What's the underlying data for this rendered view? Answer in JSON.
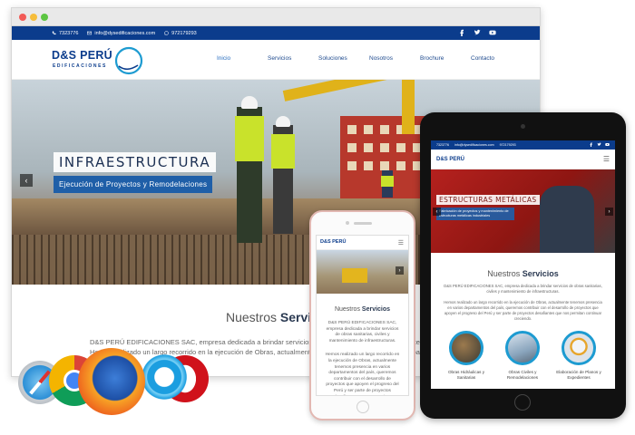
{
  "desktop": {
    "contact": {
      "phone": "7323776",
      "email": "info@dysedificaciones.com",
      "whatsapp": "972179293"
    },
    "social_icons": [
      "facebook-icon",
      "twitter-icon",
      "youtube-icon"
    ],
    "logo": {
      "brand": "D&S PERÚ",
      "sub": "EDIFICACIONES"
    },
    "menu": [
      "Inicio",
      "Servicios",
      "Soluciones",
      "Nosotros",
      "Brochure",
      "Contacto"
    ],
    "active_menu": "Inicio",
    "hero": {
      "caption_title": "INFRAESTRUCTURA",
      "caption_sub": "Ejecución de Proyectos y Remodelaciones"
    },
    "services": {
      "title_light": "Nuestros ",
      "title_bold": "Servicios",
      "paragraph": "D&S PERÚ EDIFICACIONES SAC, empresa dedicada a brindar servicios de obras sanitarias, civiles y mantenimiento de infraestructuras. Hemos realizado un largo recorrido en la ejecución de Obras, actualmente tenemos presencia en varios departamentos del país."
    }
  },
  "phone": {
    "logo": "D&S PERÚ",
    "services": {
      "title_light": "Nuestros ",
      "title_bold": "Servicios",
      "p1": "D&S PERÚ EDIFICACIONES SAC, empresa dedicada a brindar servicios de obras sanitarias, civiles y mantenimiento de infraestructuras.",
      "p2": "Hemos realizado un largo recorrido en la ejecución de Obras, actualmente tenemos presencia en varios departamentos del país, queremos contribuir con el desarrollo de proyectos que apoyen el progreso del Perú y ser parte de proyectos desafiantes que nos permitan continuar creciendo."
    }
  },
  "tablet": {
    "contact": {
      "phone": "7323776",
      "email": "info@dysedificaciones.com",
      "whatsapp": "972179293"
    },
    "logo": "D&S PERÚ",
    "hero": {
      "caption_title": "ESTRUCTURAS METÁLICAS",
      "caption_sub": "Fabricación de proyectos y mantenimiento de estructuras metálicas industriales"
    },
    "services": {
      "title_light": "Nuestros ",
      "title_bold": "Servicios",
      "p1": "D&S PERÚ EDIFICACIONES SAC, empresa dedicada a brindar servicios de obras sanitarias, civiles y mantenimiento de infraestructuras.",
      "p2": "Hemos realizado un largo recorrido en la ejecución de Obras, actualmente tenemos presencia en varios departamentos del país, queremos contribuir con el desarrollo de proyectos que apoyen el progreso del Perú y ser parte de proyectos desafiantes que nos permitan continuar creciendo."
    },
    "cards": [
      {
        "label": "Obras Hidráulicas y Sanitarias"
      },
      {
        "label": "Obras Civiles y Remodelaciones"
      },
      {
        "label": "Elaboración de Planos y Expedientes"
      }
    ]
  },
  "browser_icons": [
    "safari-icon",
    "chrome-icon",
    "firefox-icon",
    "internet-explorer-icon",
    "opera-icon"
  ],
  "colors": {
    "primary_blue": "#0b3c8c",
    "accent_blue": "#1f5fa8",
    "circle_border": "#1d9bd1"
  }
}
